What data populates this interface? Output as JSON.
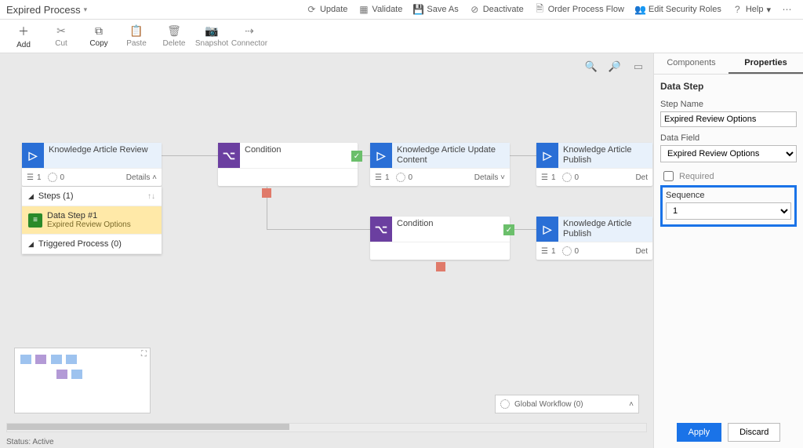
{
  "header": {
    "title": "Expired Process",
    "actions": {
      "update": "Update",
      "validate": "Validate",
      "saveas": "Save As",
      "deactivate": "Deactivate",
      "orderflow": "Order Process Flow",
      "editroles": "Edit Security Roles",
      "help": "Help"
    }
  },
  "commands": {
    "add": "Add",
    "cut": "Cut",
    "copy": "Copy",
    "paste": "Paste",
    "delete": "Delete",
    "snapshot": "Snapshot",
    "connector": "Connector"
  },
  "nodes": {
    "stage1": {
      "title": "Knowledge Article Review",
      "steps": "1",
      "count": "0",
      "details": "Details"
    },
    "cond1": {
      "title": "Condition"
    },
    "stage2": {
      "title": "Knowledge Article Update Content",
      "steps": "1",
      "count": "0",
      "details": "Details"
    },
    "stage3": {
      "title": "Knowledge Article Publish",
      "steps": "1",
      "count": "0",
      "details": "Det"
    },
    "cond2": {
      "title": "Condition"
    },
    "stage4": {
      "title": "Knowledge Article Publish",
      "steps": "1",
      "count": "0",
      "details": "Det"
    }
  },
  "stagepanel": {
    "steps": "Steps (1)",
    "datastep_title": "Data Step #1",
    "datastep_sub": "Expired Review Options",
    "triggered": "Triggered Process (0)"
  },
  "globalwf": "Global Workflow (0)",
  "status": {
    "label": "Status:",
    "value": "Active"
  },
  "sidebar": {
    "tabs": {
      "components": "Components",
      "properties": "Properties"
    },
    "section": "Data Step",
    "stepname_label": "Step Name",
    "stepname_value": "Expired Review Options",
    "datafield_label": "Data Field",
    "datafield_value": "Expired Review Options",
    "required": "Required",
    "sequence_label": "Sequence",
    "sequence_value": "1",
    "apply": "Apply",
    "discard": "Discard"
  }
}
